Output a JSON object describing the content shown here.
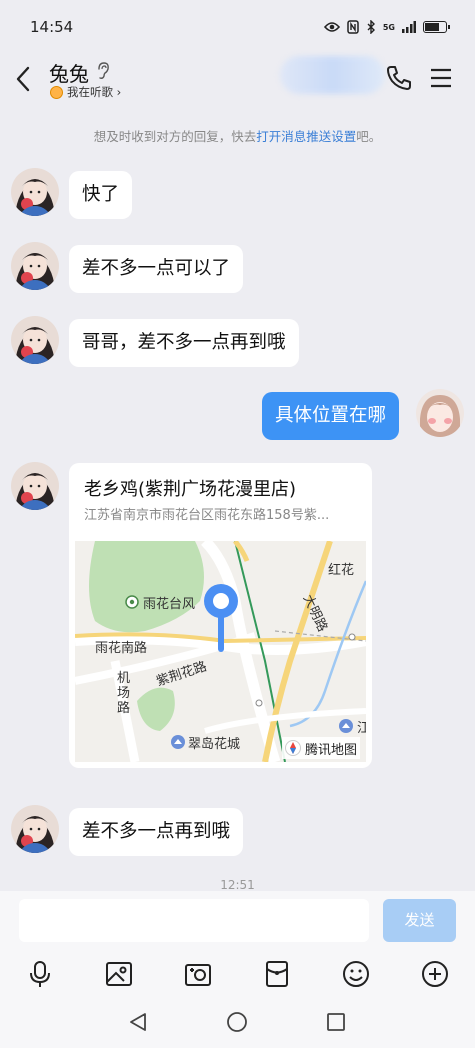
{
  "status_bar": {
    "time": "14:54",
    "network": "5G",
    "battery_level": 0.75
  },
  "header": {
    "contact_name": "兔兔",
    "contact_status": "我在听歌 ›"
  },
  "notice": {
    "prefix": "想及时收到对方的回复，快去",
    "link": "打开消息推送设置",
    "suffix": "吧。"
  },
  "messages": [
    {
      "from": "them",
      "text": "快了"
    },
    {
      "from": "them",
      "text": "差不多一点可以了"
    },
    {
      "from": "them",
      "text": "哥哥，差不多一点再到哦"
    },
    {
      "from": "me",
      "text": "具体位置在哪"
    },
    {
      "from": "them",
      "text": "差不多一点再到哦"
    }
  ],
  "location_card": {
    "title": "老乡鸡(紫荆广场花漫里店)",
    "address": "江苏省南京市雨花台区雨花东路158号紫...",
    "map_labels": {
      "poi_park": "雨花台风",
      "road_yuhua_south": "雨花南路",
      "road_zijinghua": "紫荆花路",
      "road_jichang": "机场路",
      "road_daming": "大明路",
      "area_honghua": "红花",
      "poi_cuidao": "翠岛花城",
      "poi_edge": "江"
    },
    "map_attribution": "腾讯地图"
  },
  "timestamp": "12:51",
  "input": {
    "value": "",
    "send_label": "发送"
  },
  "colors": {
    "my_bubble": "#3d93f5",
    "link": "#3b7fd6",
    "send_disabled": "#a8cdf5"
  },
  "toolbar_icons": [
    "microphone-icon",
    "image-icon",
    "camera-icon",
    "red-packet-icon",
    "emoji-icon",
    "plus-icon"
  ],
  "nav_icons": [
    "back-triangle-icon",
    "home-circle-icon",
    "recents-square-icon"
  ]
}
